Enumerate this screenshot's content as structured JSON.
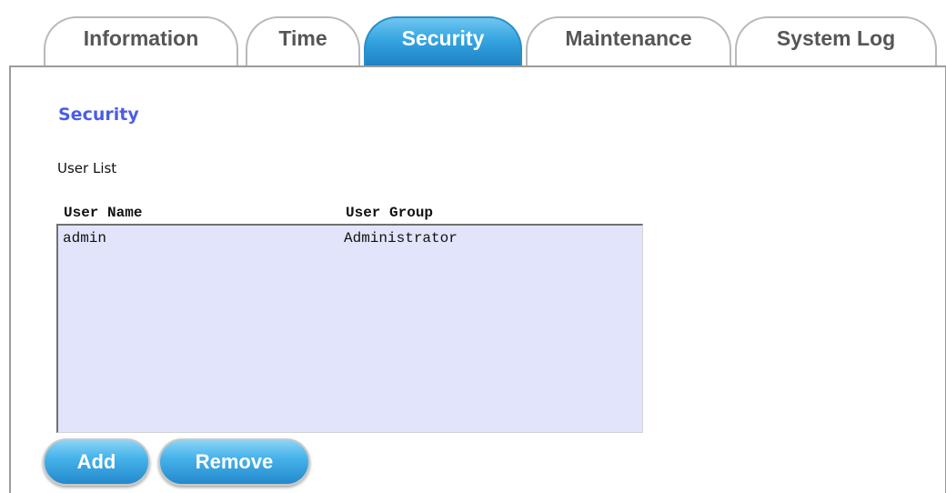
{
  "tabs": [
    {
      "label": "Information",
      "active": false
    },
    {
      "label": "Time",
      "active": false
    },
    {
      "label": "Security",
      "active": true
    },
    {
      "label": "Maintenance",
      "active": false
    },
    {
      "label": "System Log",
      "active": false
    }
  ],
  "page": {
    "title": "Security",
    "user_list_label": "User List"
  },
  "user_list": {
    "columns": [
      "User Name",
      "User Group"
    ],
    "rows": [
      {
        "user_name": "admin",
        "user_group": "Administrator"
      }
    ]
  },
  "buttons": {
    "add_label": "Add",
    "remove_label": "Remove"
  },
  "colors": {
    "title": "#4a5de8",
    "tab_active": "#34a4e0",
    "listbox_bg": "#e2e4fb",
    "button": "#47b3ea"
  }
}
